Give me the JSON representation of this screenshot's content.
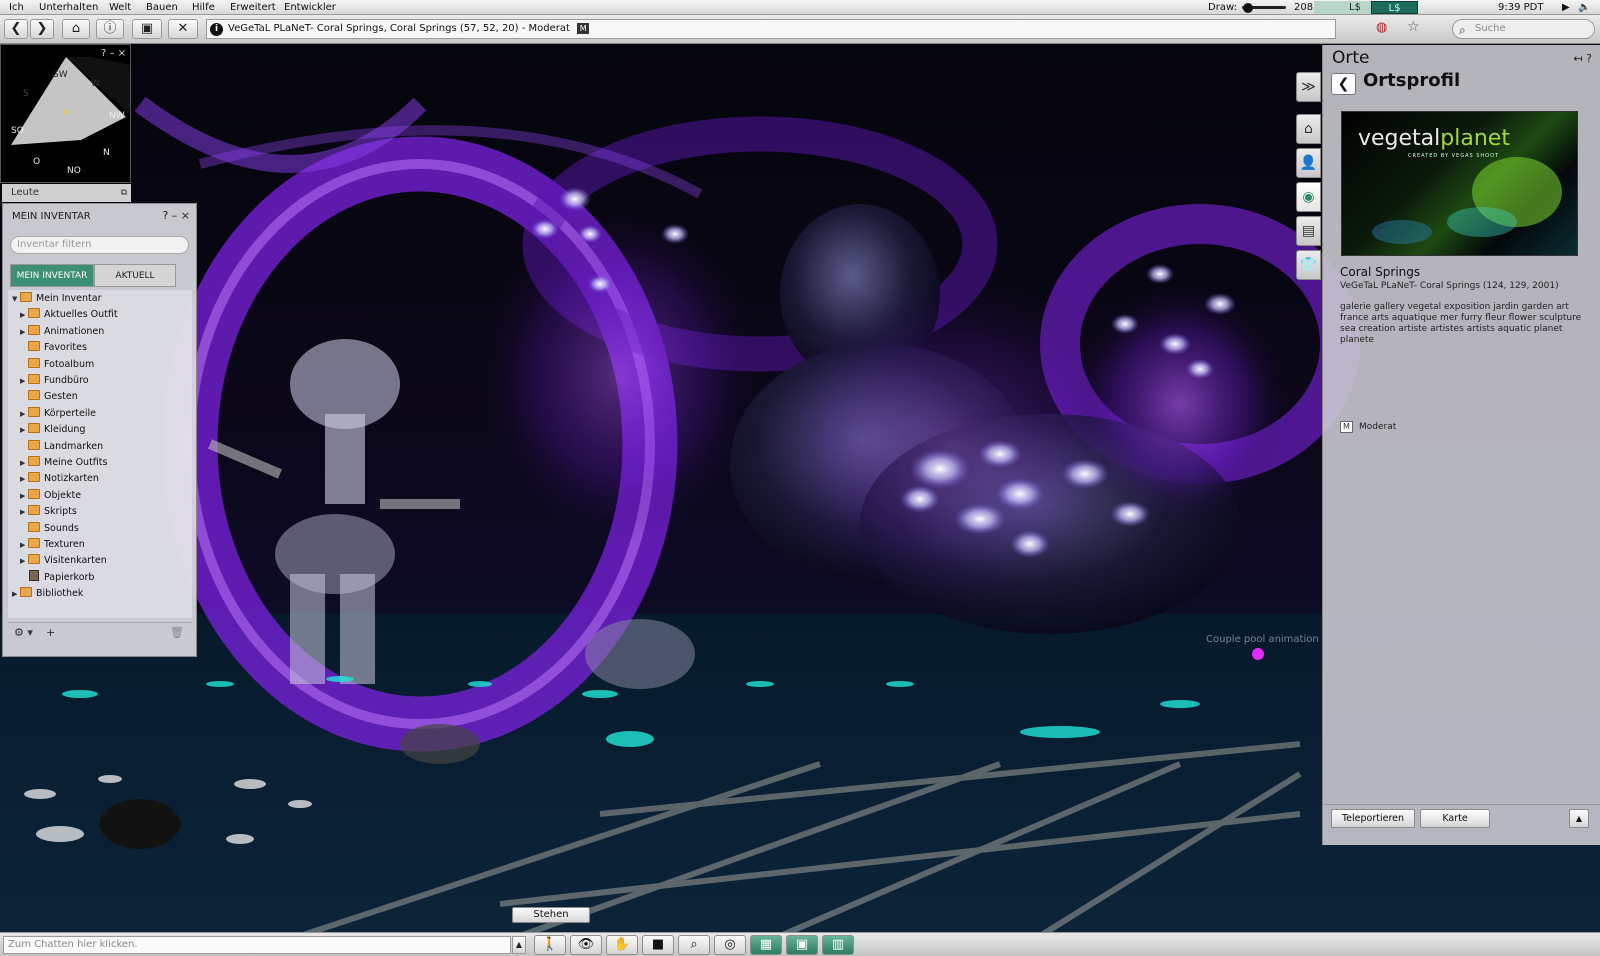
{
  "menubar": {
    "items": [
      "Ich",
      "Unterhalten",
      "Welt",
      "Bauen",
      "Hilfe",
      "Erweitert",
      "Entwickler"
    ],
    "draw_label": "Draw:",
    "draw_value": "208",
    "currency": "L$",
    "buy_label": "L$ kaufen",
    "time": "9:39 PDT"
  },
  "navbar": {
    "location": "VeGeTaL PLaNeT- Coral Springs, Coral Springs (57, 52, 20) - Moderat",
    "maturity_badge": "M",
    "search_placeholder": "Suche"
  },
  "minimap": {
    "controls": "?  –  ×",
    "directions": [
      "SW",
      "W",
      "S",
      "NW",
      "SO",
      "N",
      "O",
      "NO"
    ]
  },
  "people_bar": {
    "label": "Leute"
  },
  "inventory": {
    "title": "MEIN INVENTAR",
    "controls": "?  –  ×",
    "filter_placeholder": "Inventar filtern",
    "tabs": [
      "MEIN INVENTAR",
      "AKTUELL"
    ],
    "tree": [
      {
        "label": "Mein Inventar",
        "expanded": true,
        "level": 0
      },
      {
        "label": "Aktuelles Outfit",
        "expandable": true,
        "level": 1
      },
      {
        "label": "Animationen",
        "expandable": true,
        "level": 1
      },
      {
        "label": "Favorites",
        "expandable": false,
        "level": 1
      },
      {
        "label": "Fotoalbum",
        "expandable": false,
        "level": 1
      },
      {
        "label": "Fundbüro",
        "expandable": true,
        "level": 1
      },
      {
        "label": "Gesten",
        "expandable": false,
        "level": 1
      },
      {
        "label": "Körperteile",
        "expandable": true,
        "level": 1
      },
      {
        "label": "Kleidung",
        "expandable": true,
        "level": 1
      },
      {
        "label": "Landmarken",
        "expandable": false,
        "level": 1
      },
      {
        "label": "Meine Outfits",
        "expandable": true,
        "level": 1
      },
      {
        "label": "Notizkarten",
        "expandable": true,
        "level": 1
      },
      {
        "label": "Objekte",
        "expandable": true,
        "level": 1
      },
      {
        "label": "Skripts",
        "expandable": true,
        "level": 1
      },
      {
        "label": "Sounds",
        "expandable": false,
        "level": 1
      },
      {
        "label": "Texturen",
        "expandable": true,
        "level": 1
      },
      {
        "label": "Visitenkarten",
        "expandable": true,
        "level": 1
      },
      {
        "label": "Papierkorb",
        "expandable": false,
        "level": 1,
        "icon": "trash-icon"
      },
      {
        "label": "Bibliothek",
        "expandable": true,
        "level": 0
      }
    ],
    "bottom_gear": "⚙ ▾",
    "bottom_add": "+",
    "bottom_trash": "🗑"
  },
  "places": {
    "title": "Orte",
    "head_icons": "↤ ?",
    "profile_title": "Ortsprofil",
    "snapshot_logo_main": "vegetal",
    "snapshot_logo_accent": "planet",
    "snapshot_logo_sub": "CREATED BY VEGAS SHOOT",
    "region_name": "Coral Springs",
    "region_sub": "VeGeTaL PLaNeT- Coral Springs (124, 129, 2001)",
    "description": "galerie gallery vegetal exposition jardin garden art france arts aquatique  mer furry fleur flower sculpture  sea creation artiste artistes artists aquatic  planet planete",
    "maturity_badge": "M",
    "maturity_label": "Moderat",
    "teleport_label": "Teleportieren",
    "map_label": "Karte",
    "collapse_label": "▲"
  },
  "sidebar_tabs": [
    "≫",
    "⌂",
    "👤",
    "◉",
    "▤",
    "👕"
  ],
  "world": {
    "hover_label": "Couple pool animation"
  },
  "stand_label": "Stehen",
  "bottombar": {
    "chat_placeholder": "Zum Chatten hier klicken.",
    "chat_toggle": "▲"
  },
  "colors": {
    "accent": "#2c7c61",
    "world_purple": "#7a2fd0"
  }
}
